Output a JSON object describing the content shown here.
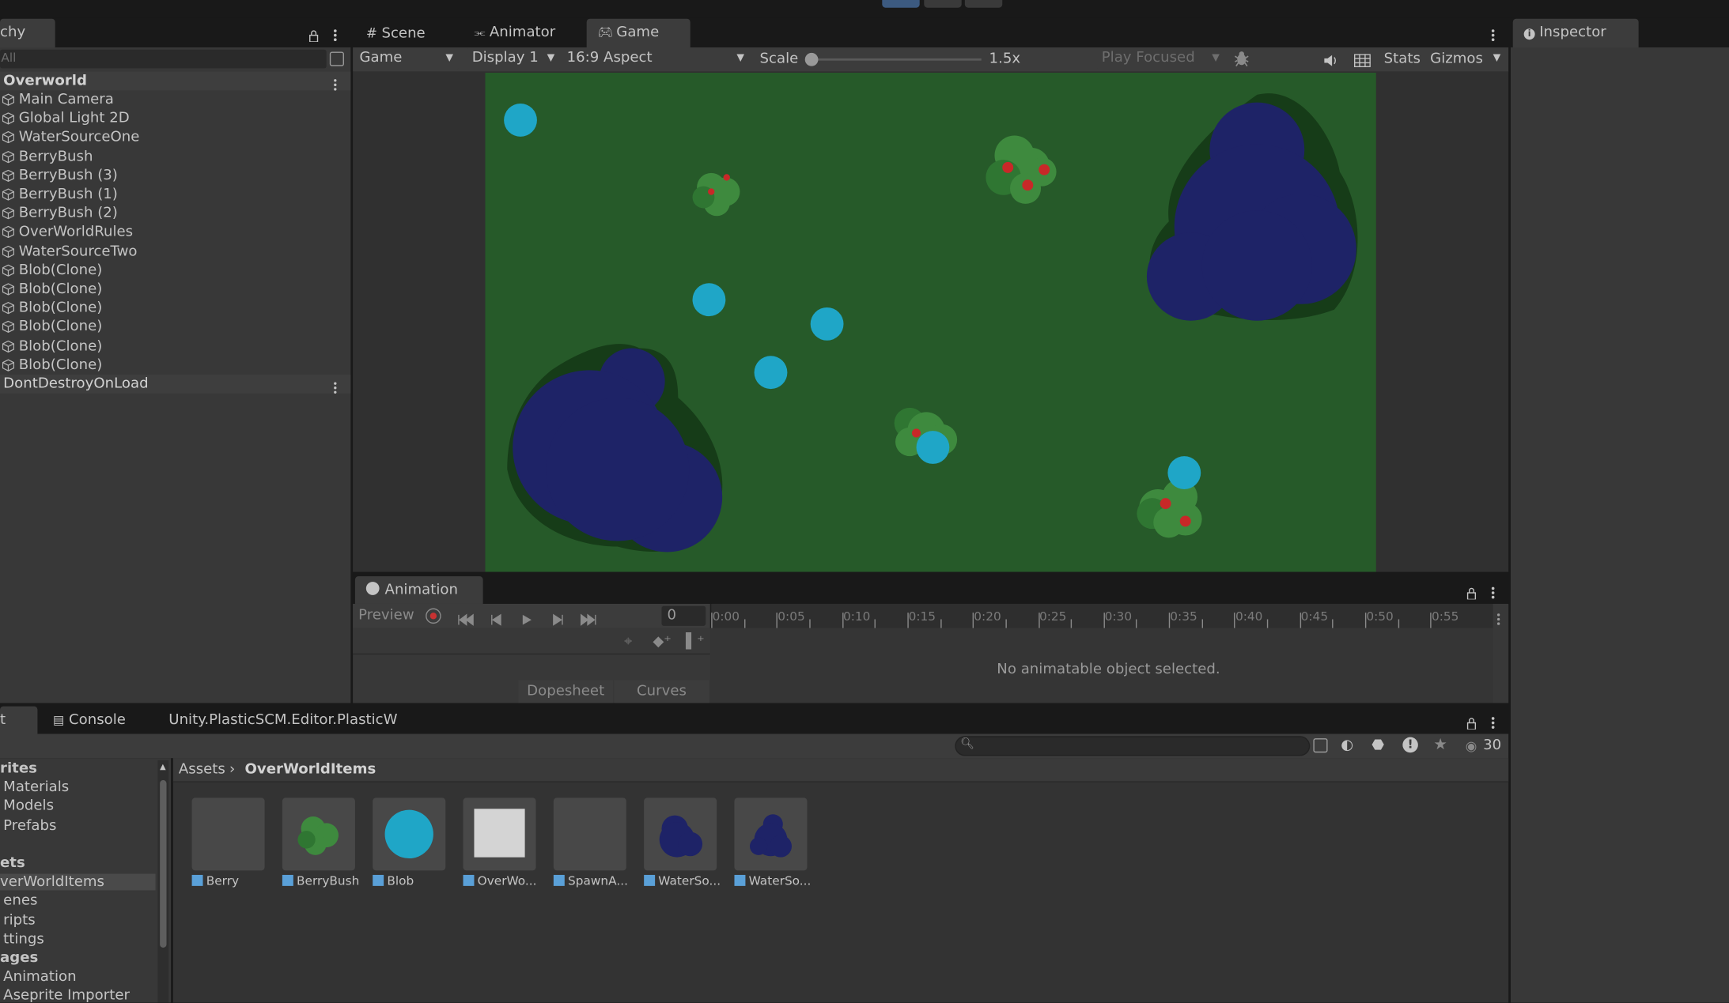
{
  "hierarchy": {
    "tab_label": "chy",
    "search_placeholder": "All",
    "scene_name": "Overworld",
    "items": [
      "Main Camera",
      "Global Light 2D",
      "WaterSourceOne",
      "BerryBush",
      "BerryBush (3)",
      "BerryBush (1)",
      "BerryBush (2)",
      "OverWorldRules",
      "WaterSourceTwo",
      "Blob(Clone)",
      "Blob(Clone)",
      "Blob(Clone)",
      "Blob(Clone)",
      "Blob(Clone)",
      "Blob(Clone)"
    ],
    "dont_destroy": "DontDestroyOnLoad"
  },
  "center_tabs": [
    "Scene",
    "Animator",
    "Game"
  ],
  "game_toolbar": {
    "game_dropdown": "Game",
    "display_dropdown": "Display 1",
    "aspect_dropdown": "16:9 Aspect",
    "scale_label": "Scale",
    "scale_value": "1.5x",
    "play_mode_dropdown": "Play Focused",
    "stats_label": "Stats",
    "gizmos_label": "Gizmos"
  },
  "inspector": {
    "tab_label": "Inspector"
  },
  "animation": {
    "tab_label": "Animation",
    "preview_label": "Preview",
    "frame_value": "0",
    "timeline_labels": [
      "0:00",
      "0:05",
      "0:10",
      "0:15",
      "0:20",
      "0:25",
      "0:30",
      "0:35",
      "0:40",
      "0:45",
      "0:50",
      "0:55"
    ],
    "empty_message": "No animatable object selected.",
    "dopesheet_label": "Dopesheet",
    "curves_label": "Curves"
  },
  "bottom_tabs": [
    "t",
    "Console",
    "Unity.PlasticSCM.Editor.PlasticW"
  ],
  "project": {
    "visible_count": "30",
    "breadcrumb_root": "Assets",
    "breadcrumb_current": "OverWorldItems",
    "tree": [
      {
        "label": "rites",
        "bold": true
      },
      {
        "label": "Materials",
        "bold": false
      },
      {
        "label": "Models",
        "bold": false
      },
      {
        "label": "Prefabs",
        "bold": false
      },
      {
        "label": "",
        "bold": false
      },
      {
        "label": "ets",
        "bold": true
      },
      {
        "label": "verWorldItems",
        "bold": false
      },
      {
        "label": "enes",
        "bold": false
      },
      {
        "label": "ripts",
        "bold": false
      },
      {
        "label": "ttings",
        "bold": false
      },
      {
        "label": "ages",
        "bold": true
      },
      {
        "label": "Animation",
        "bold": false
      },
      {
        "label": "Aseprite Importer",
        "bold": false
      }
    ],
    "assets": [
      {
        "label": "Berry",
        "thumb": "empty"
      },
      {
        "label": "BerryBush",
        "thumb": "bush"
      },
      {
        "label": "Blob",
        "thumb": "blob"
      },
      {
        "label": "OverWo...",
        "thumb": "white"
      },
      {
        "label": "SpawnA...",
        "thumb": "empty"
      },
      {
        "label": "WaterSo...",
        "thumb": "water1"
      },
      {
        "label": "WaterSo...",
        "thumb": "water2"
      }
    ]
  },
  "colors": {
    "grass": "#265a29",
    "water": "#1e2367",
    "water_edge": "#163c18",
    "blob": "#1fa6c7",
    "bush": "#3e8a3e",
    "berry": "#c82828",
    "accent": "#3c78c8"
  },
  "icons": [
    "lock-icon",
    "more-icon",
    "scene-grid-icon",
    "animator-icon",
    "gamepad-icon",
    "info-icon",
    "bug-icon",
    "speaker-icon",
    "grid-icon",
    "record-icon",
    "first-key-icon",
    "prev-key-icon",
    "play-icon",
    "next-key-icon",
    "last-key-icon",
    "search-icon",
    "star-icon",
    "eye-icon"
  ]
}
